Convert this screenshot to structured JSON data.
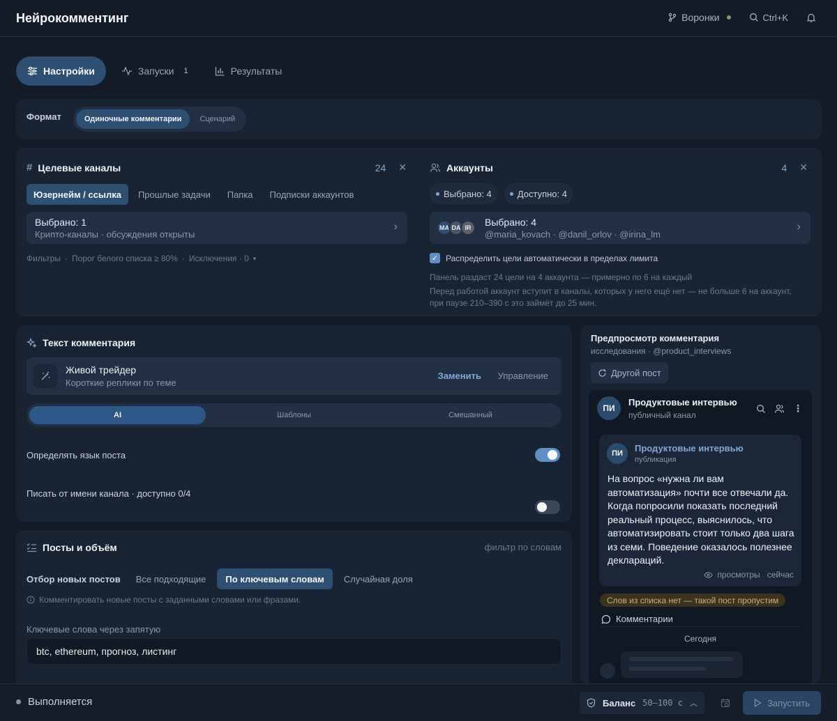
{
  "app": {
    "title": "Нейрокомментинг"
  },
  "header": {
    "funnels_label": "Воронки",
    "search_shortcut": "Ctrl+K"
  },
  "tabs": [
    {
      "label": "Настройки",
      "active": true
    },
    {
      "label": "Запуски",
      "count": "1"
    },
    {
      "label": "Результаты"
    }
  ],
  "format": {
    "label": "Формат",
    "options": [
      "Одиночные комментарии",
      "Сценарий"
    ],
    "selected": "Одиночные комментарии"
  },
  "channels": {
    "title": "Целевые каналы",
    "count": "24",
    "tabs": [
      "Юзернейм / ссылка",
      "Прошлые задачи",
      "Папка",
      "Подписки аккаунтов"
    ],
    "selected_title": "Выбрано: 1",
    "selected_sub": "Крипто-каналы · обсуждения открыты",
    "filters": {
      "label": "Фильтры",
      "whitelist": "Порог белого списка ≥ 80%",
      "exclusions": "Исключения · 0"
    }
  },
  "accounts": {
    "title": "Аккаунты",
    "count": "4",
    "pill_selected": "Выбрано: 4",
    "pill_available": "Доступно: 4",
    "avatars": [
      "MA",
      "DA",
      "IR"
    ],
    "selected_title": "Выбрано: 4",
    "selected_sub": "@maria_kovach · @danil_orlov · @irina_lm",
    "auto_distribute": "Распределить цели автоматически в пределах лимита",
    "note1": "Панель раздаст 24 цели на 4 аккаунта — примерно по 6 на каждый",
    "note2": "Перед работой аккаунт вступит в каналы, которых у него ещё нет — не больше 6 на аккаунт, при паузе 210–390 с это займёт до 25 мин."
  },
  "comment_text": {
    "title": "Текст комментария",
    "persona_name": "Живой трейдер",
    "persona_desc": "Короткие реплики по теме",
    "replace": "Заменить",
    "manage": "Управление",
    "modes": [
      "AI",
      "Шаблоны",
      "Смешанный"
    ],
    "selected_mode": "AI",
    "detect_lang": "Определять язык поста",
    "detect_lang_on": true,
    "as_channel": "Писать от имени канала · доступно 0/4",
    "as_channel_on": false
  },
  "posts": {
    "title": "Посты и объём",
    "filter_hint": "фильтр по словам",
    "selection_label": "Отбор новых постов",
    "options": [
      "Все подходящие",
      "По ключевым словам",
      "Случайная доля"
    ],
    "selected": "По ключевым словам",
    "info": "Комментировать новые посты с заданными словами или фразами.",
    "keywords_label": "Ключевые слова через запятую",
    "keywords_value": "btc, ethereum, прогноз, листинг"
  },
  "preview": {
    "title": "Предпросмотр комментария",
    "subtitle": "исследования · @product_interviews",
    "other_post": "Другой пост",
    "channel_initials": "ПИ",
    "channel_name": "Продуктовые интервью",
    "channel_type": "публичный канал",
    "post_author": "Продуктовые интервью",
    "post_kind": "публикация",
    "post_text": "На вопрос «нужна ли вам автоматизация» почти все отвечали да. Когда попросили показать последний реальный процесс, выяснилось, что автоматизировать стоит только два шага из семи. Поведение оказалось полезнее деклараций.",
    "views": "просмотры",
    "time": "сейчас",
    "warning": "Слов из списка нет — такой пост пропустим",
    "comments_label": "Комментарии",
    "today": "Сегодня"
  },
  "footer": {
    "status": "Выполняется",
    "balance_label": "Баланс",
    "balance_range": "50–100 с",
    "run_label": "Запустить"
  }
}
